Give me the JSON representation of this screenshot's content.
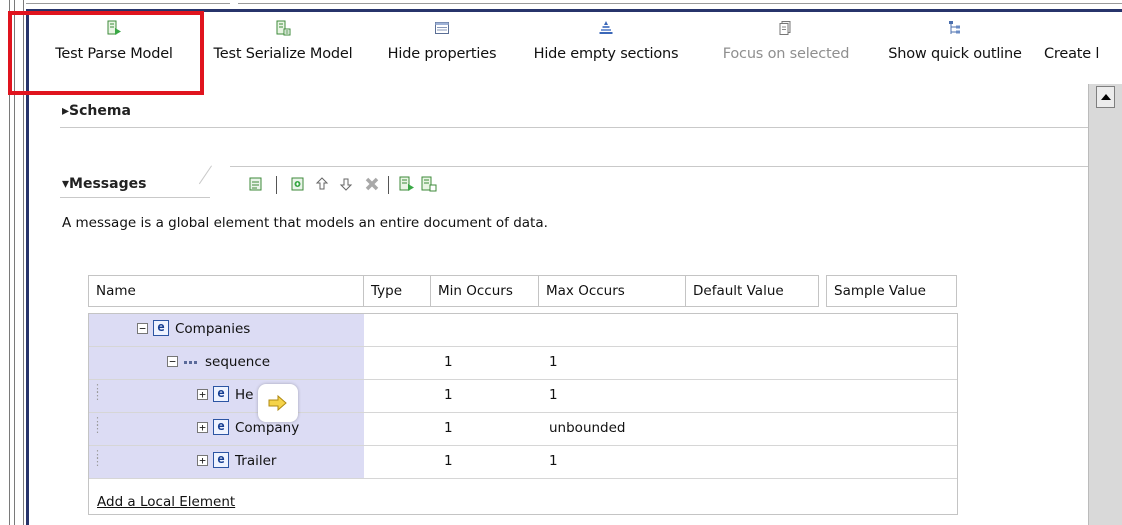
{
  "toolbar": {
    "buttons": [
      {
        "label": "Test Parse Model",
        "icon": "test-parse-icon",
        "enabled": true
      },
      {
        "label": "Test Serialize Model",
        "icon": "test-serialize-icon",
        "enabled": true
      },
      {
        "label": "Hide properties",
        "icon": "hide-properties-icon",
        "enabled": true
      },
      {
        "label": "Hide empty sections",
        "icon": "hide-empty-sections-icon",
        "enabled": true
      },
      {
        "label": "Focus on selected",
        "icon": "focus-selected-icon",
        "enabled": false
      },
      {
        "label": "Show quick outline",
        "icon": "quick-outline-icon",
        "enabled": true
      },
      {
        "label": "Create l",
        "icon": "create-icon",
        "enabled": true
      }
    ]
  },
  "highlight_color": "#e0141e",
  "sections": {
    "schema_title": "▸Schema",
    "messages_title": "▾Messages",
    "messages_description": "A message is a global element that models an entire document of data."
  },
  "messages_toolbar": {
    "icons": [
      "add-message-icon",
      "add-child-icon",
      "move-up-icon",
      "move-down-icon",
      "delete-icon",
      "test-parse-icon",
      "test-serialize-icon"
    ]
  },
  "table": {
    "columns": [
      "Name",
      "Type",
      "Min Occurs",
      "Max Occurs",
      "Default Value",
      "Sample Value"
    ],
    "rows": [
      {
        "name": "Companies",
        "kind": "e",
        "expander": "−",
        "type": "",
        "min": "",
        "max": ""
      },
      {
        "name": "sequence",
        "kind": "seq",
        "expander": "−",
        "type": "",
        "min": "1",
        "max": "1"
      },
      {
        "name": "He",
        "kind": "e",
        "expander": "+",
        "type": "",
        "min": "1",
        "max": "1"
      },
      {
        "name": "Company",
        "kind": "e-ref",
        "expander": "+",
        "type": "",
        "min": "1",
        "max": "unbounded"
      },
      {
        "name": "Trailer",
        "kind": "e",
        "expander": "+",
        "type": "",
        "min": "1",
        "max": "1"
      }
    ],
    "add_link": "Add a Local Element"
  },
  "tooltip": {
    "icon": "arrow-right-icon"
  }
}
